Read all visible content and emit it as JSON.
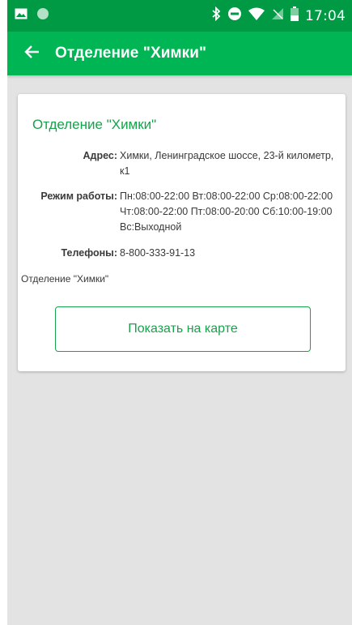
{
  "status_bar": {
    "time": "17:04",
    "icons": [
      "image-icon",
      "circle-icon",
      "bluetooth-icon",
      "do-not-disturb-icon",
      "wifi-icon",
      "no-signal-icon",
      "battery-icon"
    ]
  },
  "app_bar": {
    "title": "Отделение \"Химки\"",
    "back_icon": "arrow-left-icon"
  },
  "card": {
    "title": "Отделение \"Химки\"",
    "address_label": "Адрес:",
    "address_value": "Химки, Ленинградское шоссе, 23-й километр, к1",
    "hours_label": "Режим работы:",
    "hours_value": "Пн:08:00-22:00 Вт:08:00-22:00 Ср:08:00-22:00 Чт:08:00-22:00 Пт:08:00-20:00 Сб:10:00-19:00 Вс:Выходной",
    "phones_label": "Телефоны:",
    "phones_value": "8-800-333-91-13",
    "note": "Отделение \"Химки\"",
    "map_button_label": "Показать на карте"
  },
  "colors": {
    "status_bar": "#009a44",
    "app_bar": "#00b553",
    "accent": "#17a24c",
    "background": "#e3e3e3"
  }
}
